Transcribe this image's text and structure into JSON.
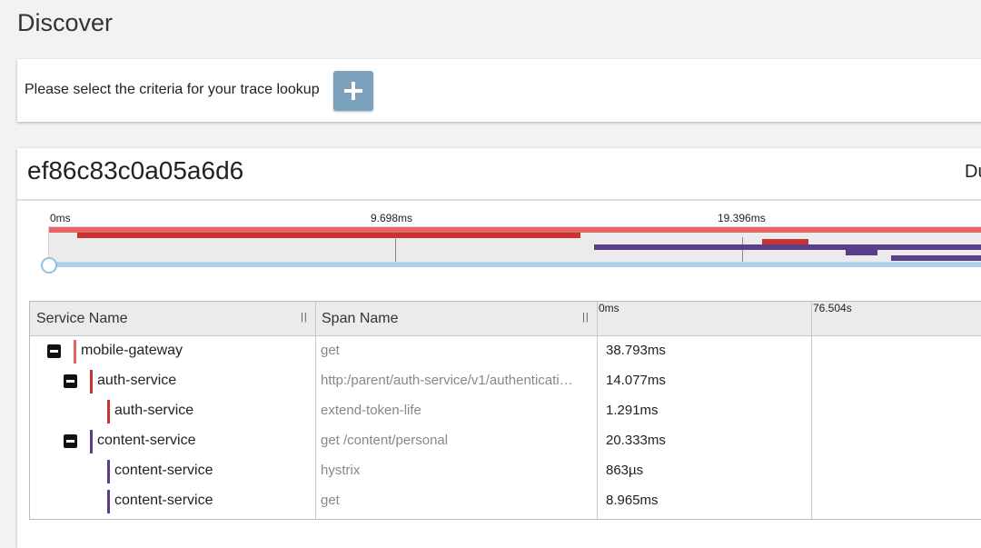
{
  "page": {
    "title": "Discover"
  },
  "criteria": {
    "text": "Please select the criteria for your trace lookup",
    "add_icon": "plus-icon"
  },
  "trace": {
    "id": "ef86c83c0a05a6d6",
    "duration_prefix": "Du",
    "timeline_labels": [
      "0ms",
      "9.698ms",
      "19.396ms"
    ],
    "colors": {
      "mobile_gateway": "#e86464",
      "auth_service": "#c83232",
      "content_service": "#5a3e8c",
      "scrubber": "#aad1ec"
    }
  },
  "table": {
    "headers": {
      "service": "Service Name",
      "span": "Span Name",
      "t0": "0ms",
      "t1": "76.504s"
    },
    "rows": [
      {
        "service": "mobile-gateway",
        "span": "get",
        "duration": "38.793ms",
        "depth": 0,
        "expanded": true,
        "color": "#e86464"
      },
      {
        "service": "auth-service",
        "span": "http:/parent/auth-service/v1/authenticati…",
        "duration": "14.077ms",
        "depth": 1,
        "expanded": true,
        "color": "#c83232"
      },
      {
        "service": "auth-service",
        "span": "extend-token-life",
        "duration": "1.291ms",
        "depth": 2,
        "expanded": null,
        "color": "#c83232"
      },
      {
        "service": "content-service",
        "span": "get /content/personal",
        "duration": "20.333ms",
        "depth": 1,
        "expanded": true,
        "color": "#5a3e8c"
      },
      {
        "service": "content-service",
        "span": "hystrix",
        "duration": "863µs",
        "depth": 2,
        "expanded": null,
        "color": "#5a3e8c"
      },
      {
        "service": "content-service",
        "span": "get",
        "duration": "8.965ms",
        "depth": 2,
        "expanded": null,
        "color": "#5a3e8c"
      }
    ]
  }
}
